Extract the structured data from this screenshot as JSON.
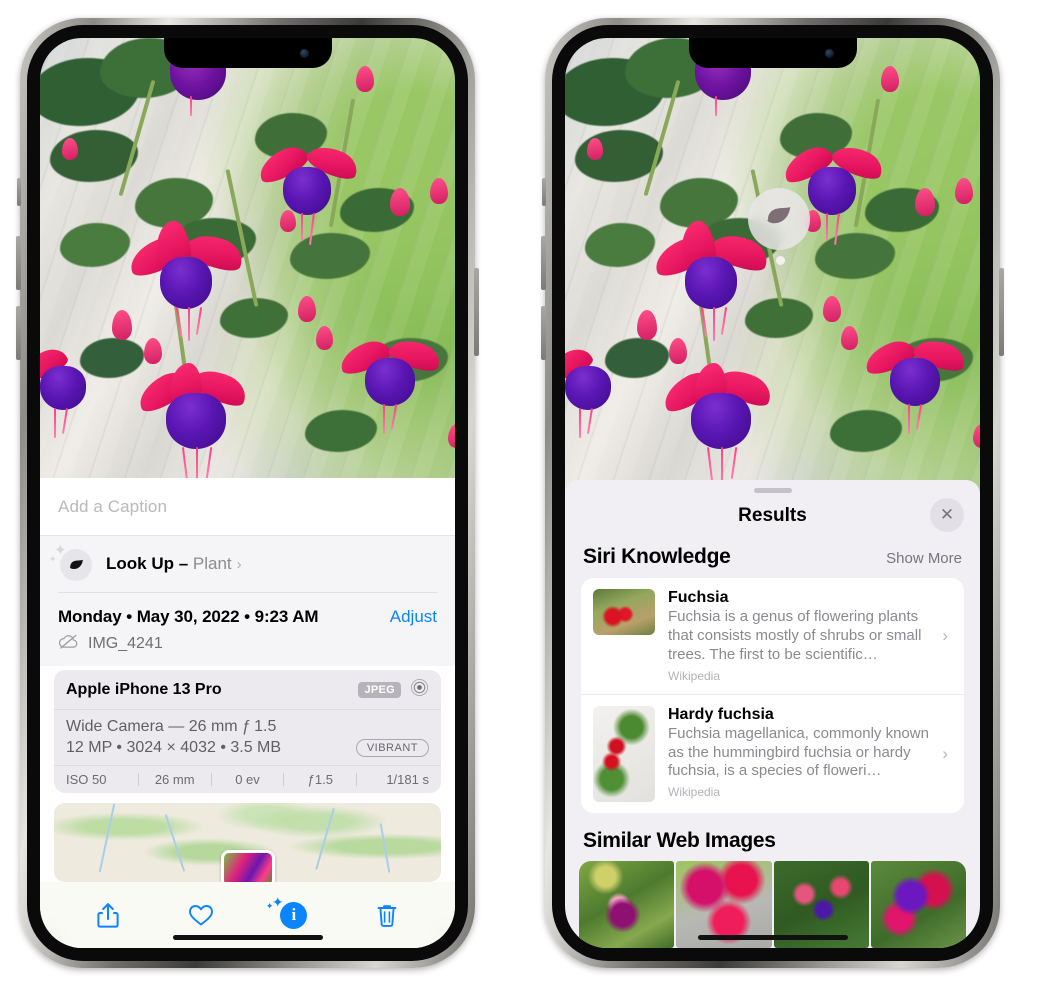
{
  "left_phone": {
    "caption": {
      "placeholder": "Add a Caption",
      "value": ""
    },
    "lookup": {
      "icon": "leaf-icon",
      "label": "Look Up – ",
      "subject": "Plant",
      "chevron": "›"
    },
    "date": {
      "text": "Monday • May 30, 2022 • 9:23 AM",
      "adjust_label": "Adjust",
      "filename": "IMG_4241",
      "cloud_icon": "cloud-slash-icon"
    },
    "metadata": {
      "device": "Apple iPhone 13 Pro",
      "format_badge": "JPEG",
      "lens_icon": "aperture-icon",
      "lens": "Wide Camera — 26 mm ƒ 1.5",
      "dimensions": "12 MP • 3024 × 4032 • 3.5 MB",
      "color_badge": "VIBRANT",
      "exif": [
        "ISO 50",
        "26 mm",
        "0 ev",
        "ƒ1.5",
        "1/181 s"
      ]
    },
    "toolbar": [
      {
        "name": "share-button",
        "icon": "share-icon"
      },
      {
        "name": "favorite-button",
        "icon": "heart-icon"
      },
      {
        "name": "info-button",
        "icon": "info-sparkle-icon"
      },
      {
        "name": "delete-button",
        "icon": "trash-icon"
      }
    ]
  },
  "right_phone": {
    "visual_lookup_badge": {
      "icon": "leaf-icon"
    },
    "sheet": {
      "title": "Results",
      "close_label": "✕"
    },
    "siri_knowledge": {
      "heading": "Siri Knowledge",
      "show_more": "Show More",
      "items": [
        {
          "title": "Fuchsia",
          "description": "Fuchsia is a genus of flowering plants that consists mostly of shrubs or small trees. The first to be scientific…",
          "source": "Wikipedia",
          "chevron": "›"
        },
        {
          "title": "Hardy fuchsia",
          "description": "Fuchsia magellanica, commonly known as the hummingbird fuchsia or hardy fuchsia, is a species of floweri…",
          "source": "Wikipedia",
          "chevron": "›"
        }
      ]
    },
    "similar_web_images": {
      "heading": "Similar Web Images",
      "thumbnails": [
        "fuchsia-thumb-1",
        "fuchsia-thumb-2",
        "fuchsia-thumb-3",
        "fuchsia-thumb-4"
      ]
    }
  },
  "colors": {
    "accent_blue": "#0a84ff",
    "sheet_bg": "#f1eff4",
    "card_bg": "#ffffff",
    "meta_card_bg": "#eceaee"
  }
}
